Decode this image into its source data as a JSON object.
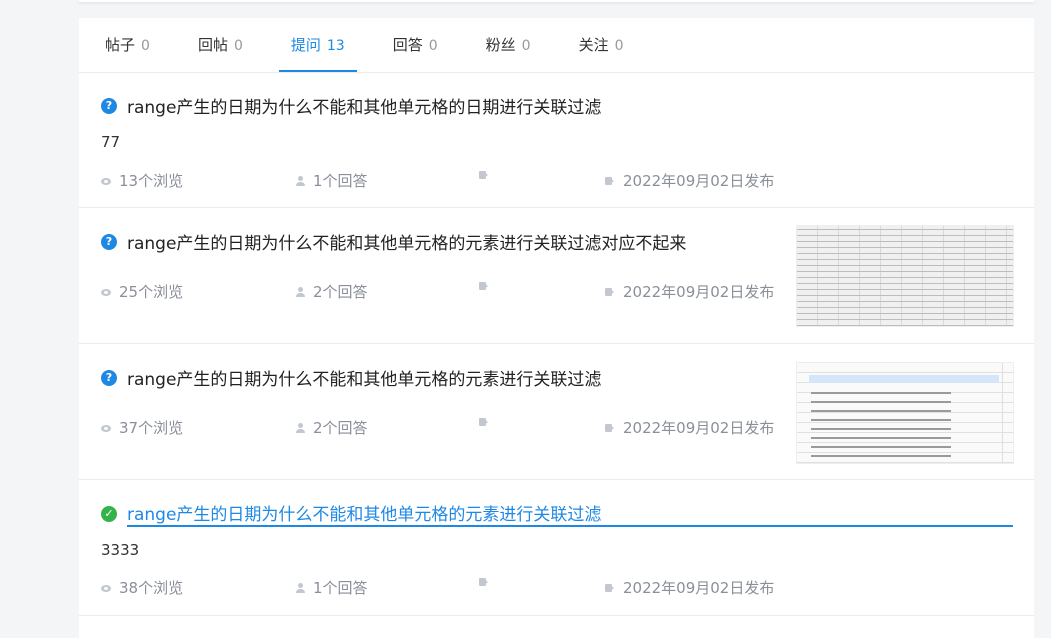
{
  "tabs": [
    {
      "label": "帖子",
      "count": "0",
      "active": false
    },
    {
      "label": "回帖",
      "count": "0",
      "active": false
    },
    {
      "label": "提问",
      "count": "13",
      "active": true
    },
    {
      "label": "回答",
      "count": "0",
      "active": false
    },
    {
      "label": "粉丝",
      "count": "0",
      "active": false
    },
    {
      "label": "关注",
      "count": "0",
      "active": false
    }
  ],
  "items": [
    {
      "status": "question",
      "title": "range产生的日期为什么不能和其他单元格的日期进行关联过滤",
      "body": "77",
      "views": "13个浏览",
      "answers": "1个回答",
      "tag": "",
      "date": "2022年09月02日发布"
    },
    {
      "status": "question",
      "title": "range产生的日期为什么不能和其他单元格的元素进行关联过滤对应不起来",
      "body": "",
      "views": "25个浏览",
      "answers": "2个回答",
      "tag": "",
      "date": "2022年09月02日发布"
    },
    {
      "status": "question",
      "title": "range产生的日期为什么不能和其他单元格的元素进行关联过滤",
      "body": "",
      "views": "37个浏览",
      "answers": "2个回答",
      "tag": "",
      "date": "2022年09月02日发布"
    },
    {
      "status": "solved",
      "title": "range产生的日期为什么不能和其他单元格的元素进行关联过滤",
      "body": "3333",
      "views": "38个浏览",
      "answers": "1个回答",
      "tag": "",
      "date": "2022年09月02日发布"
    }
  ],
  "icons": {
    "question": "?",
    "solved": "✓"
  },
  "colors": {
    "accent": "#1e88e5",
    "solved": "#33b34a",
    "meta_text": "#8a8f99"
  }
}
